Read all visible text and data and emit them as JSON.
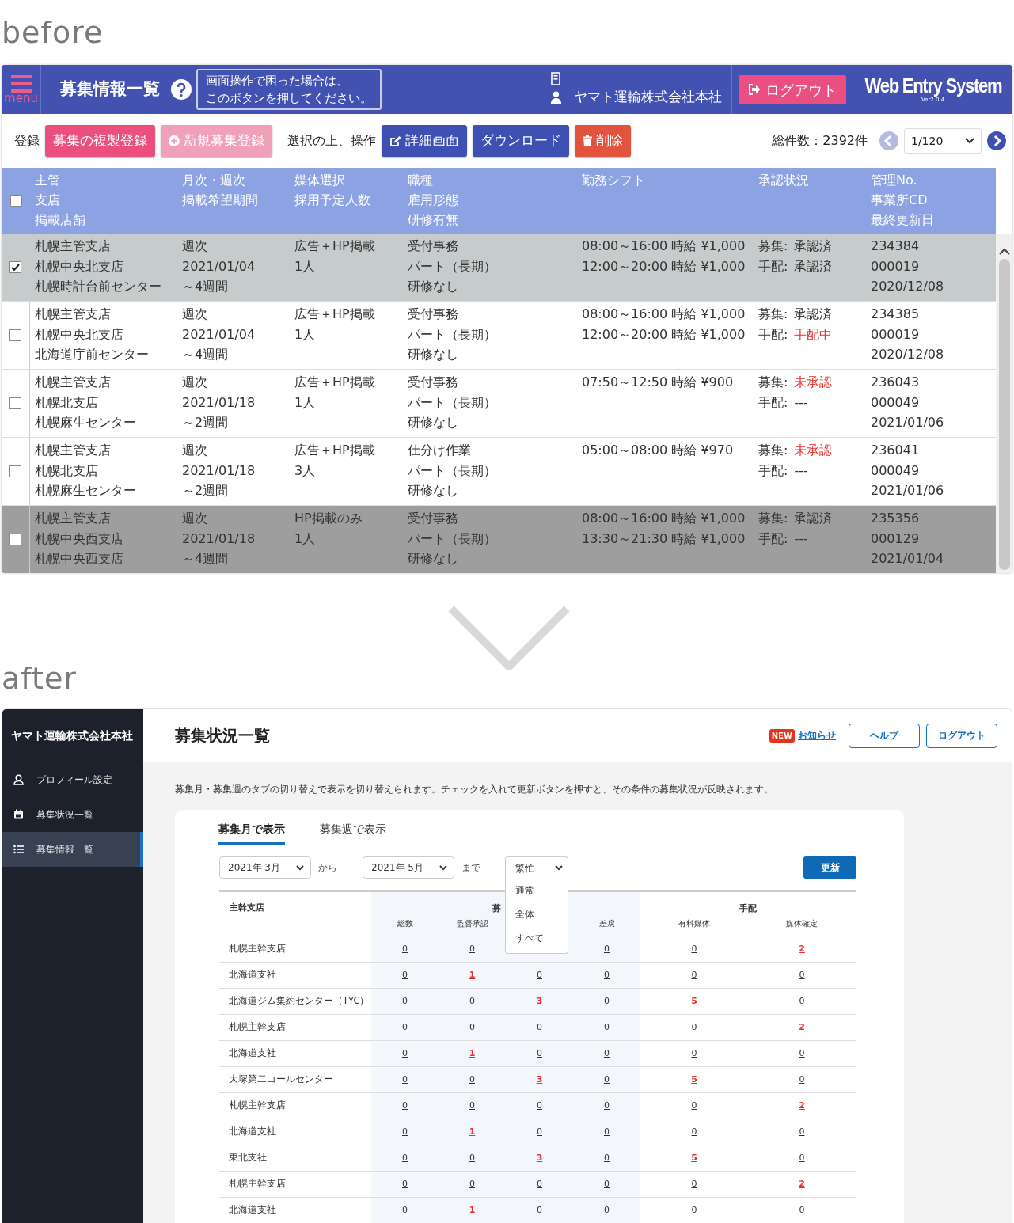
{
  "labels": {
    "before": "before",
    "after": "after"
  },
  "before": {
    "header": {
      "menu_label": "menu",
      "title": "募集情報一覧",
      "help_tooltip": [
        "画面操作で困った場合は、",
        "このボタンを押してください。"
      ],
      "company": "ヤマト運輸株式会社本社",
      "logout": "ログアウト",
      "brand": "Web Entry System",
      "version": "Ver2.0.4"
    },
    "toolbar": {
      "register_label": "登録",
      "register_buttons": [
        {
          "label": "募集の複製登録",
          "kind": "copy"
        },
        {
          "label": "新規募集登録",
          "kind": "new"
        }
      ],
      "select_label": "選択の上、操作",
      "actions": [
        {
          "label": "詳細画面",
          "kind": "detail"
        },
        {
          "label": "ダウンロード",
          "kind": "download"
        },
        {
          "label": "削除",
          "kind": "delete"
        }
      ],
      "total": "総件数：2392件",
      "page": "1/120"
    },
    "table": {
      "header_checked": false,
      "columns": [
        [
          "主管",
          "支店",
          "掲載店舗"
        ],
        [
          "月次・週次",
          "掲載希望期間"
        ],
        [
          "媒体選択",
          "採用予定人数"
        ],
        [
          "職種",
          "雇用形態",
          "研修有無"
        ],
        [
          "勤務シフト"
        ],
        [
          "承認状況"
        ],
        [
          "管理No.",
          "事業所CD",
          "最終更新日"
        ]
      ],
      "rows": [
        {
          "checked": true,
          "selected": true,
          "hovered": false,
          "branch": [
            "札幌主管支店",
            "札幌中央北支店",
            "札幌時計台前センター"
          ],
          "period": [
            "週次",
            "2021/01/04",
            "～4週間"
          ],
          "media": [
            "広告＋HP掲載",
            "1人"
          ],
          "job": [
            "受付事務",
            "パート（長期）",
            "研修なし"
          ],
          "shifts": [
            "08:00～16:00 時給 ¥1,000",
            "12:00～20:00 時給 ¥1,000"
          ],
          "status": [
            {
              "stage": "募集:",
              "state": "承認済",
              "alert": false
            },
            {
              "stage": "手配:",
              "state": "承認済",
              "alert": false
            }
          ],
          "ids": [
            "234384",
            "000019",
            "2020/12/08"
          ]
        },
        {
          "checked": false,
          "selected": false,
          "hovered": false,
          "branch": [
            "札幌主管支店",
            "札幌中央北支店",
            "北海道庁前センター"
          ],
          "period": [
            "週次",
            "2021/01/04",
            "～4週間"
          ],
          "media": [
            "広告＋HP掲載",
            "1人"
          ],
          "job": [
            "受付事務",
            "パート（長期）",
            "研修なし"
          ],
          "shifts": [
            "08:00～16:00 時給 ¥1,000",
            "12:00～20:00 時給 ¥1,000"
          ],
          "status": [
            {
              "stage": "募集:",
              "state": "承認済",
              "alert": false
            },
            {
              "stage": "手配:",
              "state": "手配中",
              "alert": true
            }
          ],
          "ids": [
            "234385",
            "000019",
            "2020/12/08"
          ]
        },
        {
          "checked": false,
          "selected": false,
          "hovered": false,
          "branch": [
            "札幌主管支店",
            "札幌北支店",
            "札幌麻生センター"
          ],
          "period": [
            "週次",
            "2021/01/18",
            "～2週間"
          ],
          "media": [
            "広告＋HP掲載",
            "1人"
          ],
          "job": [
            "受付事務",
            "パート（長期）",
            "研修なし"
          ],
          "shifts": [
            "07:50～12:50 時給 ¥900"
          ],
          "status": [
            {
              "stage": "募集:",
              "state": "未承認",
              "alert": true
            },
            {
              "stage": "手配:",
              "state": "---",
              "alert": false
            }
          ],
          "ids": [
            "236043",
            "000049",
            "2021/01/06"
          ]
        },
        {
          "checked": false,
          "selected": false,
          "hovered": false,
          "branch": [
            "札幌主管支店",
            "札幌北支店",
            "札幌麻生センター"
          ],
          "period": [
            "週次",
            "2021/01/18",
            "～2週間"
          ],
          "media": [
            "広告＋HP掲載",
            "3人"
          ],
          "job": [
            "仕分け作業",
            "パート（長期）",
            "研修なし"
          ],
          "shifts": [
            "05:00～08:00 時給 ¥970"
          ],
          "status": [
            {
              "stage": "募集:",
              "state": "未承認",
              "alert": true
            },
            {
              "stage": "手配:",
              "state": "---",
              "alert": false
            }
          ],
          "ids": [
            "236041",
            "000049",
            "2021/01/06"
          ]
        },
        {
          "checked": false,
          "selected": false,
          "hovered": true,
          "branch": [
            "札幌主管支店",
            "札幌中央西支店",
            "札幌中央西支店"
          ],
          "period": [
            "週次",
            "2021/01/18",
            "～4週間"
          ],
          "media": [
            "HP掲載のみ",
            "1人"
          ],
          "job": [
            "受付事務",
            "パート（長期）",
            "研修なし"
          ],
          "shifts": [
            "08:00～16:00 時給 ¥1,000",
            "13:30～21:30 時給 ¥1,000"
          ],
          "status": [
            {
              "stage": "募集:",
              "state": "承認済",
              "alert": false
            },
            {
              "stage": "手配:",
              "state": "---",
              "alert": false
            }
          ],
          "ids": [
            "235356",
            "000129",
            "2021/01/04"
          ]
        }
      ]
    }
  },
  "after": {
    "sidebar": {
      "company": "ヤマト運輸株式会社本社",
      "items": [
        {
          "label": "プロフィール設定",
          "kind": "person",
          "selected": false
        },
        {
          "label": "募集状況一覧",
          "kind": "calendar",
          "selected": false
        },
        {
          "label": "募集情報一覧",
          "kind": "list",
          "selected": true
        }
      ]
    },
    "header": {
      "title": "募集状況一覧",
      "badge": "NEW",
      "notice": "お知らせ",
      "buttons": [
        "ヘルプ",
        "ログアウト"
      ]
    },
    "description": "募集月・募集週のタブの切り替えで表示を切り替えられます。チェックを入れて更新ボタンを押すと、その条件の募集状況が反映されます。",
    "tabs": [
      {
        "label": "募集月で表示",
        "selected": true
      },
      {
        "label": "募集週で表示",
        "selected": false
      }
    ],
    "filters": {
      "from": "2021年 3月",
      "from_suffix": "から",
      "to": "2021年 5月",
      "to_suffix": "まで",
      "busy_select": "繁忙",
      "busy_options": [
        "通常",
        "全体",
        "すべて"
      ],
      "update": "更新"
    },
    "table": {
      "branch_header": "主幹支店",
      "groups": [
        {
          "label": "募",
          "columns": [
            {
              "label": "総数"
            },
            {
              "label": "監督承認"
            },
            {
              "covered": true
            },
            {
              "label": "差戻"
            }
          ]
        },
        {
          "label": "手配",
          "columns": [
            {
              "label": "有料媒体"
            },
            {
              "label": "媒体確定"
            }
          ]
        }
      ],
      "rows": [
        {
          "name": "札幌主幹支店",
          "cells": [
            {
              "value": "0",
              "alert": false
            },
            {
              "value": "0",
              "alert": false
            },
            {
              "covered": true
            },
            {
              "value": "0",
              "alert": false
            },
            {
              "value": "0",
              "alert": false
            },
            {
              "value": "2",
              "alert": true
            }
          ]
        },
        {
          "name": "北海道支社",
          "cells": [
            {
              "value": "0",
              "alert": false
            },
            {
              "value": "1",
              "alert": true
            },
            {
              "value": "0",
              "alert": false
            },
            {
              "value": "0",
              "alert": false
            },
            {
              "value": "0",
              "alert": false
            },
            {
              "value": "0",
              "alert": false
            }
          ]
        },
        {
          "name": "北海道ジム集約センター（TYC）",
          "cells": [
            {
              "value": "0",
              "alert": false
            },
            {
              "value": "0",
              "alert": false
            },
            {
              "value": "3",
              "alert": true
            },
            {
              "value": "0",
              "alert": false
            },
            {
              "value": "5",
              "alert": true
            },
            {
              "value": "0",
              "alert": false
            }
          ]
        },
        {
          "name": "札幌主幹支店",
          "cells": [
            {
              "value": "0",
              "alert": false
            },
            {
              "value": "0",
              "alert": false
            },
            {
              "value": "0",
              "alert": false
            },
            {
              "value": "0",
              "alert": false
            },
            {
              "value": "0",
              "alert": false
            },
            {
              "value": "2",
              "alert": true
            }
          ]
        },
        {
          "name": "北海道支社",
          "cells": [
            {
              "value": "0",
              "alert": false
            },
            {
              "value": "1",
              "alert": true
            },
            {
              "value": "0",
              "alert": false
            },
            {
              "value": "0",
              "alert": false
            },
            {
              "value": "0",
              "alert": false
            },
            {
              "value": "0",
              "alert": false
            }
          ]
        },
        {
          "name": "大塚第二コールセンター",
          "cells": [
            {
              "value": "0",
              "alert": false
            },
            {
              "value": "0",
              "alert": false
            },
            {
              "value": "3",
              "alert": true
            },
            {
              "value": "0",
              "alert": false
            },
            {
              "value": "5",
              "alert": true
            },
            {
              "value": "0",
              "alert": false
            }
          ]
        },
        {
          "name": "札幌主幹支店",
          "cells": [
            {
              "value": "0",
              "alert": false
            },
            {
              "value": "0",
              "alert": false
            },
            {
              "value": "0",
              "alert": false
            },
            {
              "value": "0",
              "alert": false
            },
            {
              "value": "0",
              "alert": false
            },
            {
              "value": "2",
              "alert": true
            }
          ]
        },
        {
          "name": "北海道支社",
          "cells": [
            {
              "value": "0",
              "alert": false
            },
            {
              "value": "1",
              "alert": true
            },
            {
              "value": "0",
              "alert": false
            },
            {
              "value": "0",
              "alert": false
            },
            {
              "value": "0",
              "alert": false
            },
            {
              "value": "0",
              "alert": false
            }
          ]
        },
        {
          "name": "東北支社",
          "cells": [
            {
              "value": "0",
              "alert": false
            },
            {
              "value": "0",
              "alert": false
            },
            {
              "value": "3",
              "alert": true
            },
            {
              "value": "0",
              "alert": false
            },
            {
              "value": "5",
              "alert": true
            },
            {
              "value": "0",
              "alert": false
            }
          ]
        },
        {
          "name": "札幌主幹支店",
          "cells": [
            {
              "value": "0",
              "alert": false
            },
            {
              "value": "0",
              "alert": false
            },
            {
              "value": "0",
              "alert": false
            },
            {
              "value": "0",
              "alert": false
            },
            {
              "value": "0",
              "alert": false
            },
            {
              "value": "2",
              "alert": true
            }
          ]
        },
        {
          "name": "北海道支社",
          "cells": [
            {
              "value": "0",
              "alert": false
            },
            {
              "value": "1",
              "alert": true
            },
            {
              "value": "0",
              "alert": false
            },
            {
              "value": "0",
              "alert": false
            },
            {
              "value": "0",
              "alert": false
            },
            {
              "value": "0",
              "alert": false
            }
          ]
        }
      ]
    }
  }
}
